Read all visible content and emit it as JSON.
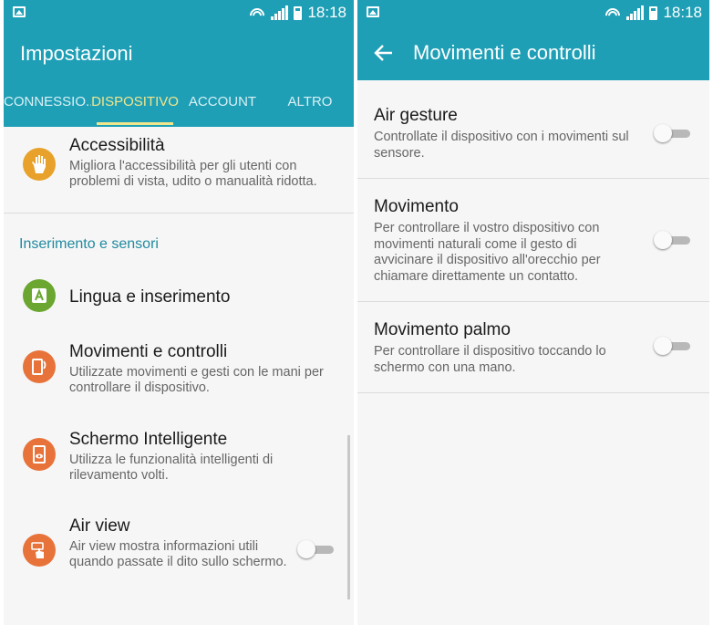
{
  "status_bar": {
    "time": "18:18"
  },
  "left": {
    "title": "Impostazioni",
    "tabs": [
      {
        "label": "CONNESSIO..",
        "active": false
      },
      {
        "label": "DISPOSITIVO",
        "active": true
      },
      {
        "label": "ACCOUNT",
        "active": false
      },
      {
        "label": "ALTRO",
        "active": false
      }
    ],
    "items": {
      "accessibility": {
        "title": "Accessibilità",
        "subtitle": "Migliora l'accessibilità per gli utenti con problemi di vista, udito o manualità ridotta.",
        "icon": "hand-icon",
        "color": "#e8a12a"
      },
      "section_header": "Inserimento e sensori",
      "language": {
        "title": "Lingua e inserimento",
        "icon": "keyboard-a-icon",
        "color": "#6aa630"
      },
      "motions": {
        "title": "Movimenti e controlli",
        "subtitle": "Utilizzate movimenti e gesti con le mani per controllare il dispositivo.",
        "icon": "motion-device-icon",
        "color": "#e8733a"
      },
      "smart_screen": {
        "title": "Schermo Intelligente",
        "subtitle": "Utilizza le funzionalità intelligenti di rilevamento volti.",
        "icon": "smart-screen-eye-icon",
        "color": "#e8733a"
      },
      "air_view": {
        "title": "Air view",
        "subtitle": "Air view mostra informazioni utili quando passate il dito sullo schermo.",
        "icon": "air-view-hand-icon",
        "color": "#e8733a",
        "enabled": false
      }
    }
  },
  "right": {
    "title": "Movimenti e controlli",
    "items": [
      {
        "title": "Air gesture",
        "subtitle": "Controllate il dispositivo con i movimenti sul sensore.",
        "enabled": false
      },
      {
        "title": "Movimento",
        "subtitle": "Per controllare il vostro dispositivo con movimenti naturali come il gesto di avvicinare il dispositivo all'orecchio per chiamare direttamente un contatto.",
        "enabled": false
      },
      {
        "title": "Movimento palmo",
        "subtitle": "Per controllare il dispositivo toccando lo schermo con una mano.",
        "enabled": false
      }
    ]
  },
  "colors": {
    "accent": "#1f9fb6",
    "tab_active": "#f0e68c",
    "section_header": "#1f8aa0"
  }
}
